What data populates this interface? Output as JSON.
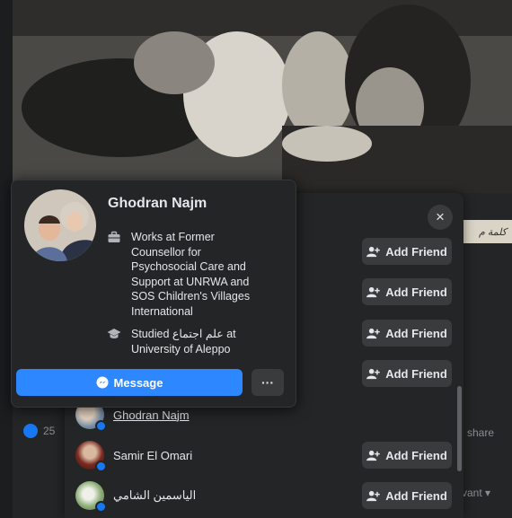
{
  "background": {
    "sidetag_text": "كلمة م",
    "reaction_count": "25",
    "share_text": "1 share",
    "relevant_text": "vant"
  },
  "dialog": {
    "close_symbol": "×",
    "add_friend_label": "Add Friend",
    "people": [
      {
        "name": "Ghodran Najm"
      },
      {
        "name": "Samir El Omari"
      },
      {
        "name": "الياسمين الشامي"
      }
    ]
  },
  "profile_card": {
    "name": "Ghodran Najm",
    "work": "Works at Former Counsellor for Psychosocial Care and Support at UNRWA and SOS Children's Villages International",
    "study": "Studied علم اجتماع at University of Aleppo",
    "message_label": "Message",
    "more_label": "···"
  },
  "colors": {
    "accent": "#2d88ff",
    "surface": "#242526",
    "button": "#3a3b3c"
  },
  "icons": [
    "close-icon",
    "add-friend-icon",
    "briefcase-icon",
    "graduation-cap-icon",
    "messenger-icon",
    "more-icon"
  ]
}
